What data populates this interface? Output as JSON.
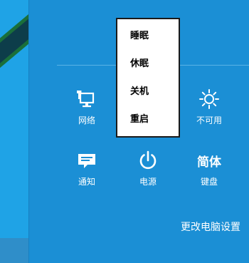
{
  "power_menu": {
    "items": [
      {
        "label": "睡眠"
      },
      {
        "label": "休眠"
      },
      {
        "label": "关机"
      },
      {
        "label": "重启"
      }
    ]
  },
  "tiles": {
    "network": {
      "label": "网络",
      "icon": "network-icon"
    },
    "brightness": {
      "label": "不可用",
      "icon": "brightness-icon"
    },
    "notifications": {
      "label": "通知",
      "icon": "notifications-icon"
    },
    "power": {
      "label": "电源",
      "icon": "power-icon"
    },
    "keyboard": {
      "label": "键盘",
      "glyph": "简体"
    }
  },
  "settings_link": "更改电脑设置",
  "colors": {
    "pane": "#1b8fd5",
    "left_strip": "#1fa3e6",
    "menu_bg": "#ffffff",
    "text": "#ffffff"
  }
}
